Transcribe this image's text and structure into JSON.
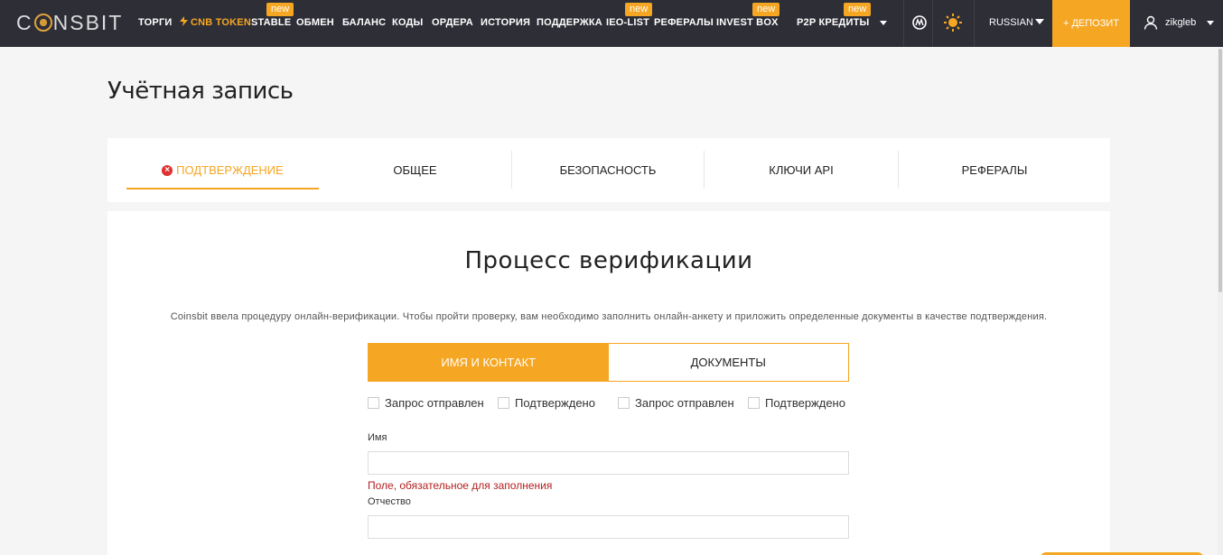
{
  "brand": {
    "logo_text_left": "C",
    "logo_text_right": "NSBIT"
  },
  "nav": {
    "items": [
      {
        "label": "ТОРГИ"
      },
      {
        "label": "CNB TOKEN"
      },
      {
        "label": "STABLE",
        "badge": "new"
      },
      {
        "label": "ОБМЕН"
      },
      {
        "label": "БАЛАНС"
      },
      {
        "label": "КОДЫ"
      },
      {
        "label": "ОРДЕРА"
      },
      {
        "label": "ИСТОРИЯ"
      },
      {
        "label": "ПОДДЕРЖКА"
      },
      {
        "label": "IEO-LIST",
        "badge": "new"
      },
      {
        "label": "РЕФЕРАЛЫ"
      },
      {
        "label": "INVEST BOX",
        "badge": "new"
      },
      {
        "label": "P2P КРЕДИТЫ",
        "badge": "new"
      }
    ],
    "language": "RUSSIAN",
    "deposit": "+ ДЕПОЗИТ",
    "username": "zikgleb",
    "accent": "#f5a623"
  },
  "page": {
    "title": "Учётная запись"
  },
  "tabs": [
    {
      "label": "ПОДТВЕРЖДЕНИЕ",
      "icon": "error-icon",
      "active": true
    },
    {
      "label": "ОБЩЕЕ"
    },
    {
      "label": "БЕЗОПАСНОСТЬ"
    },
    {
      "label": "КЛЮЧИ API"
    },
    {
      "label": "РЕФЕРАЛЫ"
    }
  ],
  "verification": {
    "title": "Процесс верификации",
    "description": "Coinsbit ввела процедуру онлайн-верификации. Чтобы пройти проверку, вам необходимо заполнить онлайн-анкету и приложить определенные документы в качестве подтверждения.",
    "steps": [
      {
        "label": "ИМЯ И КОНТАКТ",
        "active": true
      },
      {
        "label": "ДОКУМЕНТЫ"
      }
    ],
    "statuses": [
      {
        "sent": "Запрос отправлен",
        "confirmed": "Подтверждено"
      },
      {
        "sent": "Запрос отправлен",
        "confirmed": "Подтверждено"
      }
    ],
    "fields": {
      "first_name_label": "Имя",
      "first_name_value": "",
      "first_name_error": "Поле, обязательное для заполнения",
      "patronymic_label": "Отчество",
      "patronymic_value": ""
    }
  }
}
